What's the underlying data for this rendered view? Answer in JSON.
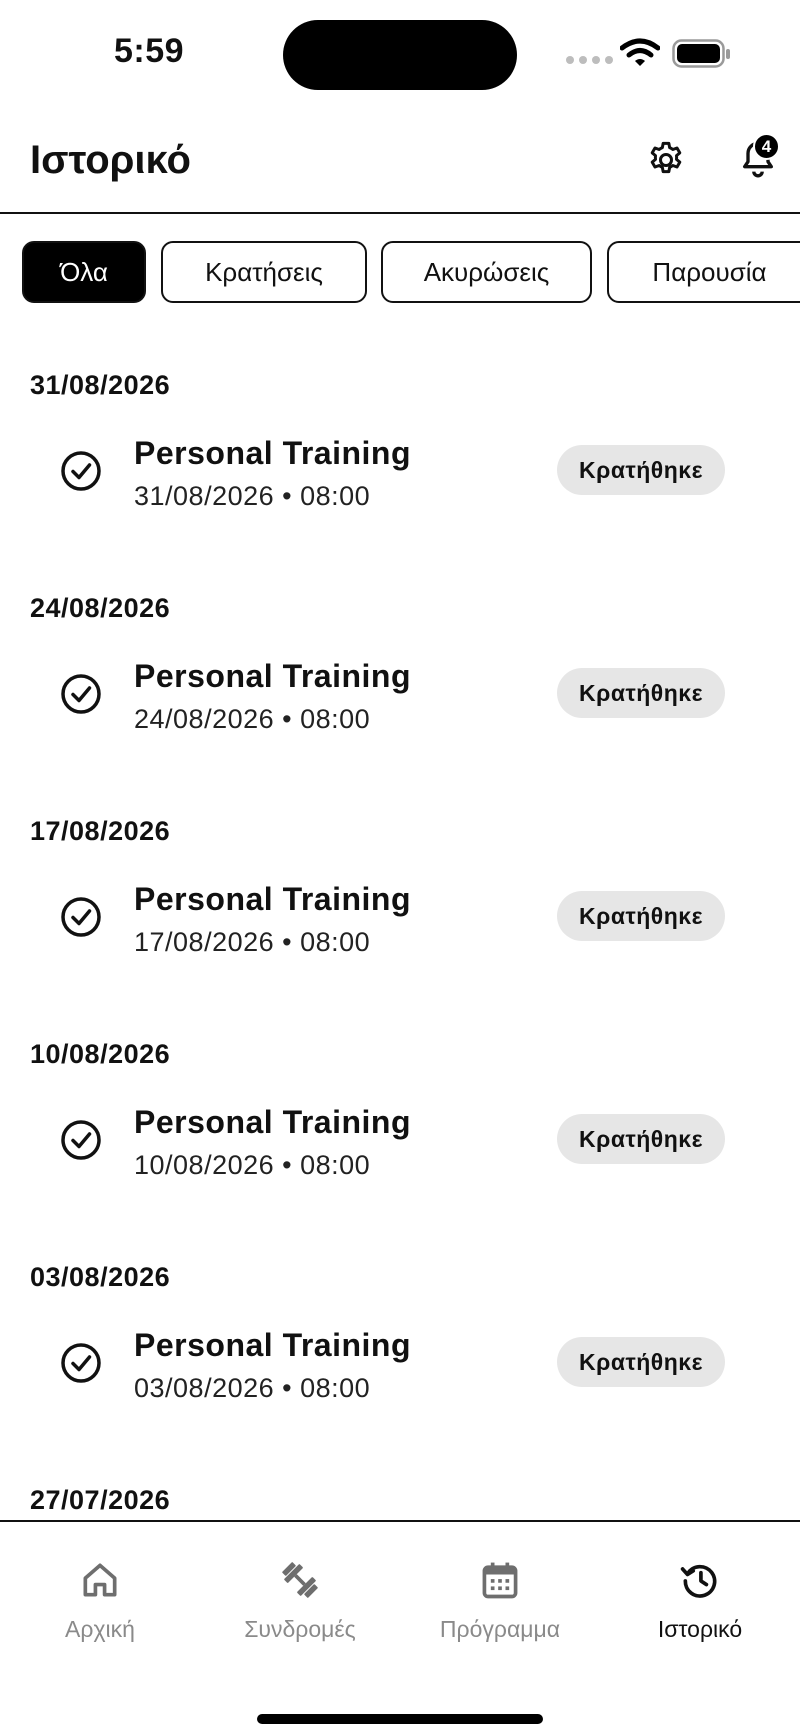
{
  "status_bar": {
    "time": "5:59"
  },
  "header": {
    "title": "Ιστορικό",
    "notification_count": "4"
  },
  "filters": [
    {
      "label": "Όλα",
      "active": true
    },
    {
      "label": "Κρατήσεις",
      "active": false
    },
    {
      "label": "Ακυρώσεις",
      "active": false
    },
    {
      "label": "Παρουσία",
      "active": false
    }
  ],
  "history": [
    {
      "date": "31/08/2026",
      "entry": {
        "title": "Personal Training",
        "subtitle": "31/08/2026 • 08:00",
        "status": "Κρατήθηκε"
      }
    },
    {
      "date": "24/08/2026",
      "entry": {
        "title": "Personal Training",
        "subtitle": "24/08/2026 • 08:00",
        "status": "Κρατήθηκε"
      }
    },
    {
      "date": "17/08/2026",
      "entry": {
        "title": "Personal Training",
        "subtitle": "17/08/2026 • 08:00",
        "status": "Κρατήθηκε"
      }
    },
    {
      "date": "10/08/2026",
      "entry": {
        "title": "Personal Training",
        "subtitle": "10/08/2026 • 08:00",
        "status": "Κρατήθηκε"
      }
    },
    {
      "date": "03/08/2026",
      "entry": {
        "title": "Personal Training",
        "subtitle": "03/08/2026 • 08:00",
        "status": "Κρατήθηκε"
      }
    },
    {
      "date": "27/07/2026"
    }
  ],
  "bottom_nav": [
    {
      "label": "Αρχική",
      "icon": "home-icon",
      "active": false
    },
    {
      "label": "Συνδρομές",
      "icon": "dumbbell-icon",
      "active": false
    },
    {
      "label": "Πρόγραμμα",
      "icon": "calendar-icon",
      "active": false
    },
    {
      "label": "Ιστορικό",
      "icon": "history-icon",
      "active": true
    }
  ]
}
